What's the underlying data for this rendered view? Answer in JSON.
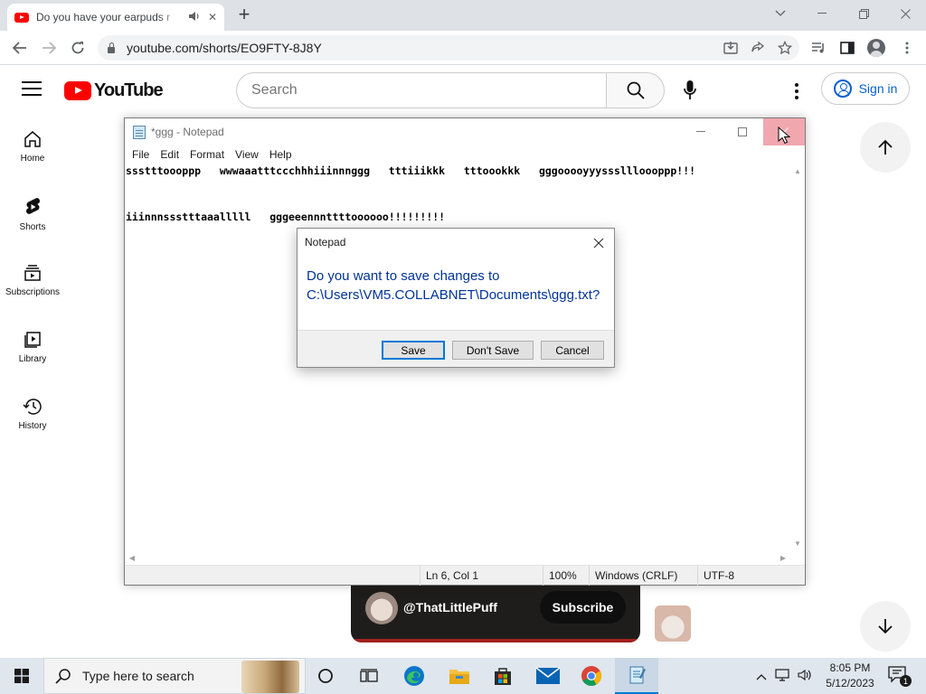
{
  "browser": {
    "tab_title": "Do you have your earpuds r",
    "new_tab_label": "+",
    "url": "youtube.com/shorts/EO9FTY-8J8Y"
  },
  "youtube": {
    "logo_text": "YouTube",
    "search_placeholder": "Search",
    "signin_label": "Sign in",
    "sidebar": [
      {
        "label": "Home",
        "icon": "home-icon"
      },
      {
        "label": "Shorts",
        "icon": "shorts-icon"
      },
      {
        "label": "Subscriptions",
        "icon": "subscriptions-icon"
      },
      {
        "label": "Library",
        "icon": "library-icon"
      },
      {
        "label": "History",
        "icon": "history-icon"
      }
    ],
    "short": {
      "channel": "@ThatLittlePuff",
      "subscribe_label": "Subscribe"
    }
  },
  "notepad": {
    "title": "*ggg - Notepad",
    "menu": [
      "File",
      "Edit",
      "Format",
      "View",
      "Help"
    ],
    "text": "ssstttoooppp   wwwaaatttccchhhiiinnnggg   tttiiikkk   tttoookkk   gggooooyyysssllloooppp!!!\n\n\niiinnnssstttaaalllll   gggeeennnttttoooooo!!!!!!!!!",
    "status": {
      "position": "Ln 6, Col 1",
      "zoom": "100%",
      "line_ending": "Windows (CRLF)",
      "encoding": "UTF-8"
    }
  },
  "dialog": {
    "title": "Notepad",
    "message_line1": "Do you want to save changes to",
    "message_line2": "C:\\Users\\VM5.COLLABNET\\Documents\\ggg.txt?",
    "save_label": "Save",
    "dont_save_label": "Don't Save",
    "cancel_label": "Cancel"
  },
  "taskbar": {
    "search_placeholder": "Type here to search",
    "time": "8:05 PM",
    "date": "5/12/2023",
    "notification_count": "1"
  },
  "colors": {
    "youtube_red": "#ff0000",
    "signin_blue": "#065fd4",
    "dialog_text": "#003399",
    "focus_blue": "#0078d7",
    "close_hover": "#f1a7ae"
  }
}
